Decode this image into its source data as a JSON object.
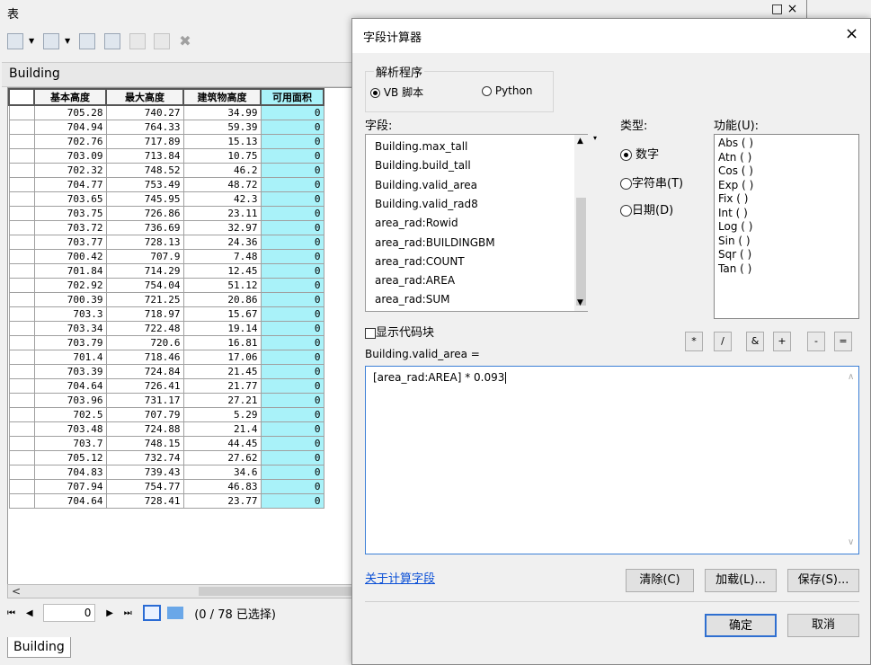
{
  "table_window": {
    "title": "表",
    "window_buttons": "□ ×",
    "table_name": "Building",
    "columns": [
      "基本高度",
      "最大高度",
      "建筑物高度",
      "可用面积"
    ],
    "rows": [
      [
        "705.28",
        "740.27",
        "34.99",
        "0"
      ],
      [
        "704.94",
        "764.33",
        "59.39",
        "0"
      ],
      [
        "702.76",
        "717.89",
        "15.13",
        "0"
      ],
      [
        "703.09",
        "713.84",
        "10.75",
        "0"
      ],
      [
        "702.32",
        "748.52",
        "46.2",
        "0"
      ],
      [
        "704.77",
        "753.49",
        "48.72",
        "0"
      ],
      [
        "703.65",
        "745.95",
        "42.3",
        "0"
      ],
      [
        "703.75",
        "726.86",
        "23.11",
        "0"
      ],
      [
        "703.72",
        "736.69",
        "32.97",
        "0"
      ],
      [
        "703.77",
        "728.13",
        "24.36",
        "0"
      ],
      [
        "700.42",
        "707.9",
        "7.48",
        "0"
      ],
      [
        "701.84",
        "714.29",
        "12.45",
        "0"
      ],
      [
        "702.92",
        "754.04",
        "51.12",
        "0"
      ],
      [
        "700.39",
        "721.25",
        "20.86",
        "0"
      ],
      [
        "703.3",
        "718.97",
        "15.67",
        "0"
      ],
      [
        "703.34",
        "722.48",
        "19.14",
        "0"
      ],
      [
        "703.79",
        "720.6",
        "16.81",
        "0"
      ],
      [
        "701.4",
        "718.46",
        "17.06",
        "0"
      ],
      [
        "703.39",
        "724.84",
        "21.45",
        "0"
      ],
      [
        "704.64",
        "726.41",
        "21.77",
        "0"
      ],
      [
        "703.96",
        "731.17",
        "27.21",
        "0"
      ],
      [
        "702.5",
        "707.79",
        "5.29",
        "0"
      ],
      [
        "703.48",
        "724.88",
        "21.4",
        "0"
      ],
      [
        "703.7",
        "748.15",
        "44.45",
        "0"
      ],
      [
        "705.12",
        "732.74",
        "27.62",
        "0"
      ],
      [
        "704.83",
        "739.43",
        "34.6",
        "0"
      ],
      [
        "707.94",
        "754.77",
        "46.83",
        "0"
      ],
      [
        "704.64",
        "728.41",
        "23.77",
        "0"
      ]
    ],
    "nav": {
      "first": "⏮",
      "prev": "◀",
      "record": "0",
      "next": "▶",
      "last": "⏭",
      "count": "(0 / 78 已选择)"
    },
    "bottom_tab": "Building",
    "scroll_left": "<"
  },
  "dialog": {
    "title": "字段计算器",
    "close": "×",
    "parser_label": "解析程序",
    "parser_vb": "VB 脚本",
    "parser_python": "Python",
    "fields_label": "字段:",
    "fields": [
      "Building.max_tall",
      "Building.build_tall",
      "Building.valid_area",
      "Building.valid_rad8",
      "area_rad:Rowid",
      "area_rad:BUILDINGBM",
      "area_rad:COUNT",
      "area_rad:AREA",
      "area_rad:SUM"
    ],
    "type_label": "类型:",
    "types": [
      "数字",
      "字符串(T)",
      "日期(D)"
    ],
    "func_label": "功能(U):",
    "functions": [
      "Abs ( )",
      "Atn ( )",
      "Cos ( )",
      "Exp ( )",
      "Fix ( )",
      "Int ( )",
      "Log ( )",
      "Sin ( )",
      "Sqr ( )",
      "Tan ( )"
    ],
    "show_code": "显示代码块",
    "operators": [
      "*",
      "/",
      "&",
      "+",
      "-",
      "="
    ],
    "expr_label": "Building.valid_area =",
    "expression": "[area_rad:AREA] * 0.093",
    "about_link": "关于计算字段",
    "clear": "清除(C)",
    "load": "加载(L)...",
    "save": "保存(S)...",
    "ok": "确定",
    "cancel": "取消"
  },
  "colors": {
    "selected_column": "#a9f2f9",
    "link": "#0a4fd6",
    "focus": "#2f6fd0"
  }
}
